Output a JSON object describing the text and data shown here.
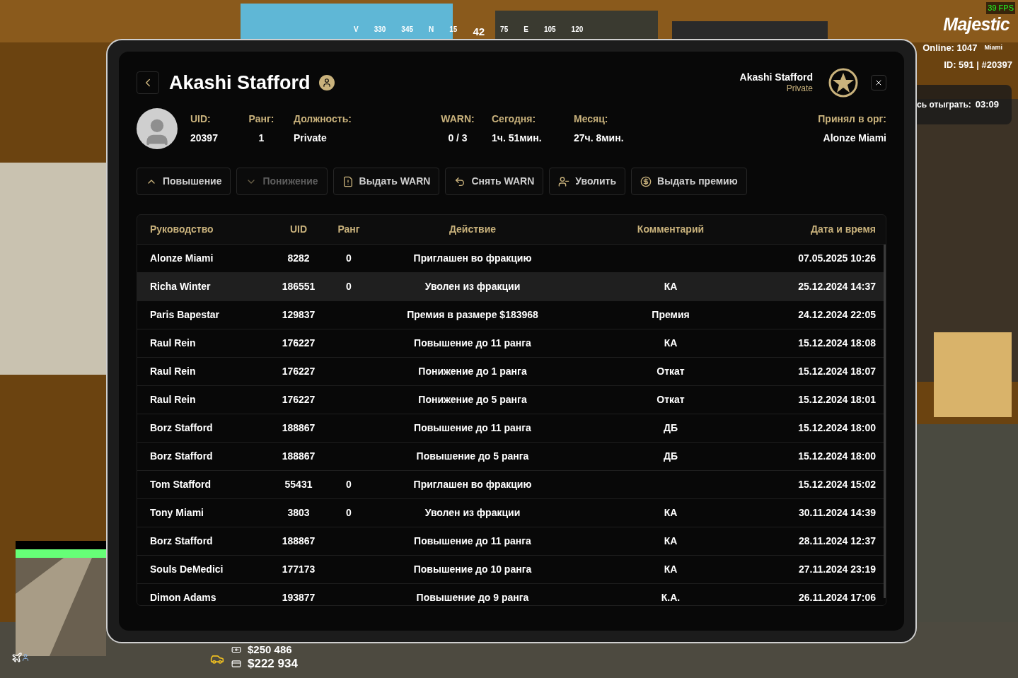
{
  "hud": {
    "fps": "39 FPS",
    "logo": "Majestic",
    "online": "Online: 1047",
    "server": "Miami",
    "id": "ID: 591 | #20397",
    "timer_label": "сь отыграть:",
    "timer_value": "03:09",
    "cash": "$250 486",
    "bank": "$222 934",
    "compass": [
      "V",
      "330",
      "345",
      "N",
      "15",
      "42",
      "75",
      "E",
      "105",
      "120"
    ]
  },
  "panel": {
    "title": "Akashi Stafford",
    "user_name": "Akashi Stafford",
    "user_rank": "Private",
    "stats": [
      {
        "label": "UID:",
        "value": "20397"
      },
      {
        "label": "Ранг:",
        "value": "1"
      },
      {
        "label": "Должность:",
        "value": "Private"
      },
      {
        "label": "WARN:",
        "value": "0 / 3"
      },
      {
        "label": "Сегодня:",
        "value": "1ч. 51мин."
      },
      {
        "label": "Месяц:",
        "value": "27ч. 8мин."
      },
      {
        "label": "Принял в орг:",
        "value": "Alonze Miami"
      }
    ],
    "actions": [
      {
        "kind": "up",
        "label": "Повышение",
        "disabled": false
      },
      {
        "kind": "down",
        "label": "Понижение",
        "disabled": true
      },
      {
        "kind": "warn",
        "label": "Выдать WARN",
        "disabled": false
      },
      {
        "kind": "unwarn",
        "label": "Снять WARN",
        "disabled": false
      },
      {
        "kind": "fire",
        "label": "Уволить",
        "disabled": false
      },
      {
        "kind": "bonus",
        "label": "Выдать премию",
        "disabled": false
      }
    ],
    "table": {
      "columns": [
        "Руководство",
        "UID",
        "Ранг",
        "Действие",
        "Комментарий",
        "Дата и время"
      ],
      "rows": [
        {
          "selected": false,
          "cells": [
            "Alonze Miami",
            "8282",
            "0",
            "Приглашен во фракцию",
            "",
            "07.05.2025 10:26"
          ]
        },
        {
          "selected": true,
          "cells": [
            "Richa Winter",
            "186551",
            "0",
            "Уволен из фракции",
            "КА",
            "25.12.2024 14:37"
          ]
        },
        {
          "selected": false,
          "cells": [
            "Paris Bapestar",
            "129837",
            "",
            "Премия в размере $183968",
            "Премия",
            "24.12.2024 22:05"
          ]
        },
        {
          "selected": false,
          "cells": [
            "Raul Rein",
            "176227",
            "",
            "Повышение до 11 ранга",
            "КА",
            "15.12.2024 18:08"
          ]
        },
        {
          "selected": false,
          "cells": [
            "Raul Rein",
            "176227",
            "",
            "Понижение до 1 ранга",
            "Откат",
            "15.12.2024 18:07"
          ]
        },
        {
          "selected": false,
          "cells": [
            "Raul Rein",
            "176227",
            "",
            "Понижение до 5 ранга",
            "Откат",
            "15.12.2024 18:01"
          ]
        },
        {
          "selected": false,
          "cells": [
            "Borz Stafford",
            "188867",
            "",
            "Повышение до 11 ранга",
            "ДБ",
            "15.12.2024 18:00"
          ]
        },
        {
          "selected": false,
          "cells": [
            "Borz Stafford",
            "188867",
            "",
            "Повышение до 5 ранга",
            "ДБ",
            "15.12.2024 18:00"
          ]
        },
        {
          "selected": false,
          "cells": [
            "Tom Stafford",
            "55431",
            "0",
            "Приглашен во фракцию",
            "",
            "15.12.2024 15:02"
          ]
        },
        {
          "selected": false,
          "cells": [
            "Tony Miami",
            "3803",
            "0",
            "Уволен из фракции",
            "КА",
            "30.11.2024 14:39"
          ]
        },
        {
          "selected": false,
          "cells": [
            "Borz Stafford",
            "188867",
            "",
            "Повышение до 11 ранга",
            "КА",
            "28.11.2024 12:37"
          ]
        },
        {
          "selected": false,
          "cells": [
            "Souls DeMedici",
            "177173",
            "",
            "Повышение до 10 ранга",
            "КА",
            "27.11.2024 23:19"
          ]
        },
        {
          "selected": false,
          "cells": [
            "Dimon Adams",
            "193877",
            "",
            "Повышение до 9 ранга",
            "К.А.",
            "26.11.2024 17:06"
          ]
        }
      ]
    }
  }
}
